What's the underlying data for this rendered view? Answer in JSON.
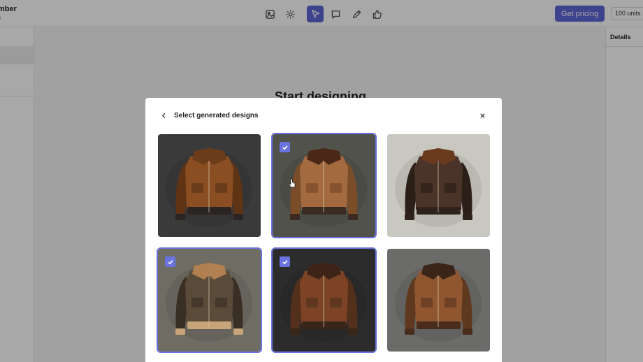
{
  "app": {
    "project_title": "mber",
    "project_subtitle": "n",
    "toolbar_icons": [
      "image-edit-icon",
      "settings-gear-icon",
      "pointer-select-icon",
      "comment-icon",
      "pencil-icon",
      "thumbs-up-icon"
    ],
    "active_tool": "pointer-select-icon",
    "pricing_button": "Get pricing",
    "units_badge": "100 units",
    "details_label": "Details",
    "canvas_heading": "Start designing",
    "accent_color": "#5d67d6"
  },
  "modal": {
    "title": "Select generated designs",
    "back_icon": "chevron-left-icon",
    "close_icon": "close-icon",
    "designs": [
      {
        "selected": false,
        "description": "tan suede bomber, black cuffs",
        "bg": "#3a3a3a"
      },
      {
        "selected": true,
        "description": "light tan suede flight jacket with dark collar",
        "bg": "#52524c"
      },
      {
        "selected": false,
        "description": "dark brown leather bomber",
        "bg": "#c9c8c0"
      },
      {
        "selected": true,
        "description": "olive-brown suede bomber with shearling collar",
        "bg": "#6e6c63"
      },
      {
        "selected": true,
        "description": "brown suede bomber with dark collar",
        "bg": "#2c2c2c"
      },
      {
        "selected": false,
        "description": "tan suede bomber with corduroy collar",
        "bg": "#6b6b6a"
      }
    ]
  }
}
